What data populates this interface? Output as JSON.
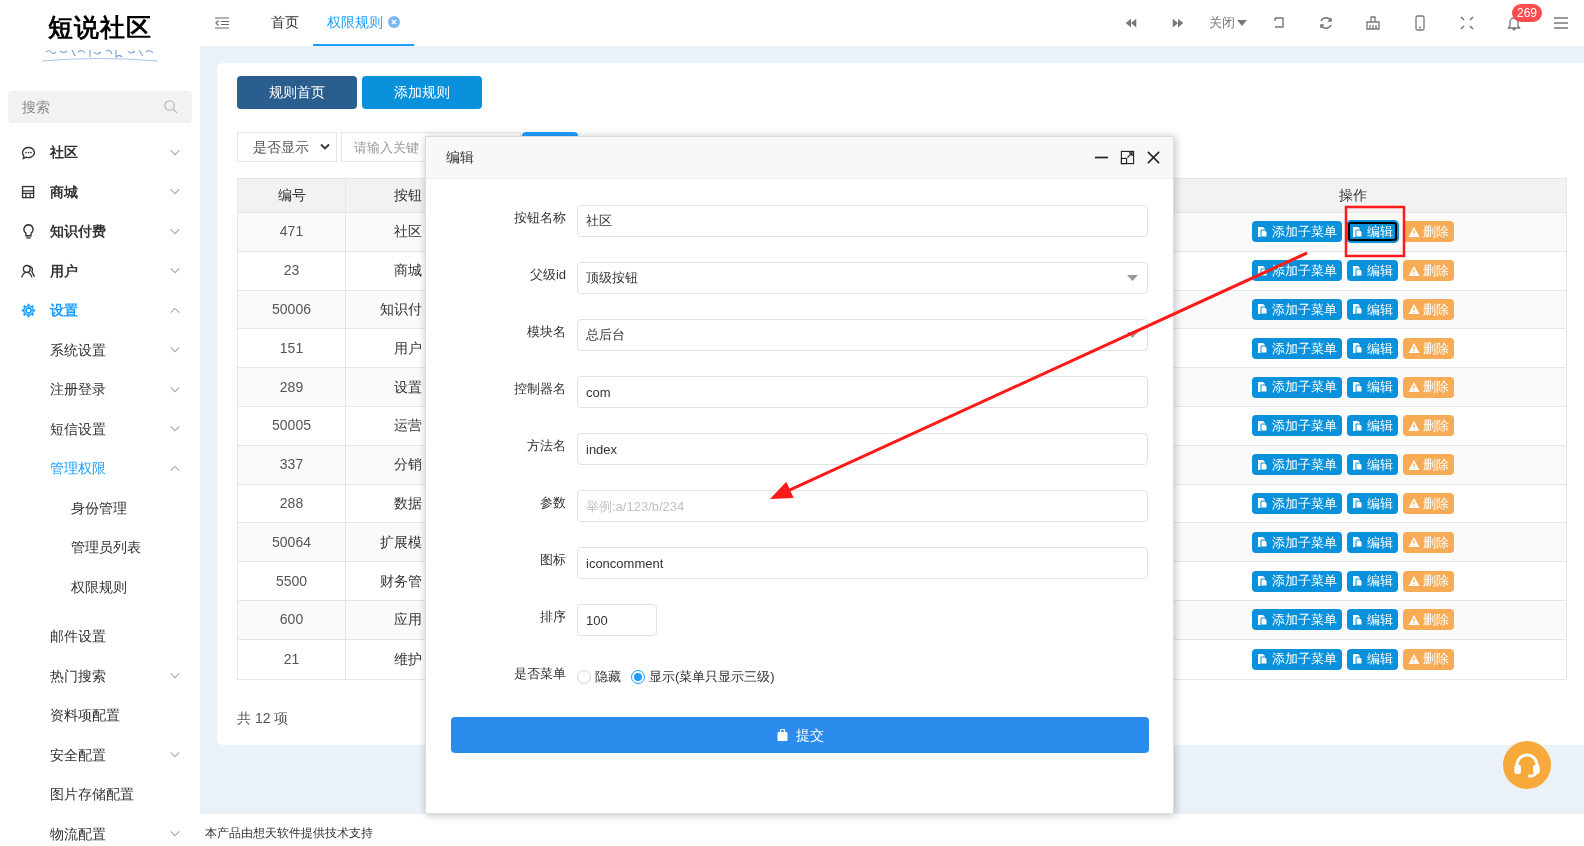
{
  "sidebar": {
    "logo": "短说社区",
    "search": {
      "placeholder": "搜索"
    },
    "items": [
      {
        "label": "社区",
        "expandable": true,
        "expanded": false
      },
      {
        "label": "商城",
        "expandable": true,
        "expanded": false
      },
      {
        "label": "知识付费",
        "expandable": true,
        "expanded": false
      },
      {
        "label": "用户",
        "expandable": true,
        "expanded": false
      },
      {
        "label": "设置",
        "expandable": true,
        "expanded": true,
        "children": [
          {
            "label": "系统设置",
            "expandable": true,
            "expanded": false
          },
          {
            "label": "注册登录",
            "expandable": true,
            "expanded": false
          },
          {
            "label": "短信设置",
            "expandable": true,
            "expanded": false
          },
          {
            "label": "管理权限",
            "expandable": true,
            "expanded": true,
            "children": [
              {
                "label": "身份管理"
              },
              {
                "label": "管理员列表"
              },
              {
                "label": "权限规则"
              }
            ]
          },
          {
            "label": "邮件设置",
            "expandable": false,
            "expanded": false
          },
          {
            "label": "热门搜索",
            "expandable": true,
            "expanded": false
          },
          {
            "label": "资料项配置",
            "expandable": false,
            "expanded": false
          },
          {
            "label": "安全配置",
            "expandable": true,
            "expanded": false
          },
          {
            "label": "图片存储配置",
            "expandable": false,
            "expanded": false
          },
          {
            "label": "物流配置",
            "expandable": true,
            "expanded": false
          }
        ]
      }
    ]
  },
  "tabs": [
    {
      "label": "首页",
      "selected": false,
      "closable": false
    },
    {
      "label": "权限规则",
      "selected": true,
      "closable": true
    }
  ],
  "toolbar": {
    "close_menu": "关闭",
    "notification_count": "269"
  },
  "page_buttons": [
    {
      "label": "规则首页",
      "selected": true
    },
    {
      "label": "添加规则",
      "selected": false
    }
  ],
  "filter": {
    "select": "是否显示",
    "keyword_placeholder": "请输入关键"
  },
  "table": {
    "columns": [
      "编号",
      "按钮",
      "操作"
    ],
    "rows": [
      {
        "id": "471",
        "name": "社区",
        "actions": [
          {
            "kind": "add",
            "label": "添加子菜单",
            "focused": false
          },
          {
            "kind": "edit",
            "label": "编辑",
            "focused": true
          },
          {
            "kind": "delete",
            "label": "删除",
            "focused": false
          }
        ]
      },
      {
        "id": "23",
        "name": "商城",
        "actions": [
          {
            "kind": "add",
            "label": "添加子菜单",
            "focused": false
          },
          {
            "kind": "edit",
            "label": "编辑",
            "focused": false
          },
          {
            "kind": "delete",
            "label": "删除",
            "focused": false
          }
        ]
      },
      {
        "id": "50006",
        "name": "知识付",
        "actions": [
          {
            "kind": "add",
            "label": "添加子菜单",
            "focused": false
          },
          {
            "kind": "edit",
            "label": "编辑",
            "focused": false
          },
          {
            "kind": "delete",
            "label": "删除",
            "focused": false
          }
        ]
      },
      {
        "id": "151",
        "name": "用户",
        "actions": [
          {
            "kind": "add",
            "label": "添加子菜单",
            "focused": false
          },
          {
            "kind": "edit",
            "label": "编辑",
            "focused": false
          },
          {
            "kind": "delete",
            "label": "删除",
            "focused": false
          }
        ]
      },
      {
        "id": "289",
        "name": "设置",
        "actions": [
          {
            "kind": "add",
            "label": "添加子菜单",
            "focused": false
          },
          {
            "kind": "edit",
            "label": "编辑",
            "focused": false
          },
          {
            "kind": "delete",
            "label": "删除",
            "focused": false
          }
        ]
      },
      {
        "id": "50005",
        "name": "运营",
        "actions": [
          {
            "kind": "add",
            "label": "添加子菜单",
            "focused": false
          },
          {
            "kind": "edit",
            "label": "编辑",
            "focused": false
          },
          {
            "kind": "delete",
            "label": "删除",
            "focused": false
          }
        ]
      },
      {
        "id": "337",
        "name": "分销",
        "actions": [
          {
            "kind": "add",
            "label": "添加子菜单",
            "focused": false
          },
          {
            "kind": "edit",
            "label": "编辑",
            "focused": false
          },
          {
            "kind": "delete",
            "label": "删除",
            "focused": false
          }
        ]
      },
      {
        "id": "288",
        "name": "数据",
        "actions": [
          {
            "kind": "add",
            "label": "添加子菜单",
            "focused": false
          },
          {
            "kind": "edit",
            "label": "编辑",
            "focused": false
          },
          {
            "kind": "delete",
            "label": "删除",
            "focused": false
          }
        ]
      },
      {
        "id": "50064",
        "name": "扩展模",
        "actions": [
          {
            "kind": "add",
            "label": "添加子菜单",
            "focused": false
          },
          {
            "kind": "edit",
            "label": "编辑",
            "focused": false
          },
          {
            "kind": "delete",
            "label": "删除",
            "focused": false
          }
        ]
      },
      {
        "id": "5500",
        "name": "财务管",
        "actions": [
          {
            "kind": "add",
            "label": "添加子菜单",
            "focused": false
          },
          {
            "kind": "edit",
            "label": "编辑",
            "focused": false
          },
          {
            "kind": "delete",
            "label": "删除",
            "focused": false
          }
        ]
      },
      {
        "id": "600",
        "name": "应用",
        "actions": [
          {
            "kind": "add",
            "label": "添加子菜单",
            "focused": false
          },
          {
            "kind": "edit",
            "label": "编辑",
            "focused": false
          },
          {
            "kind": "delete",
            "label": "删除",
            "focused": false
          }
        ]
      },
      {
        "id": "21",
        "name": "维护",
        "actions": [
          {
            "kind": "add",
            "label": "添加子菜单",
            "focused": false
          },
          {
            "kind": "edit",
            "label": "编辑",
            "focused": false
          },
          {
            "kind": "delete",
            "label": "删除",
            "focused": false
          }
        ]
      }
    ]
  },
  "total": "共 12 项",
  "dialog": {
    "title": "编辑",
    "fields": [
      {
        "label": "按钮名称",
        "kind": "text",
        "value": "社区"
      },
      {
        "label": "父级id",
        "kind": "select",
        "value": "顶级按钮"
      },
      {
        "label": "模块名",
        "kind": "select",
        "value": "总后台"
      },
      {
        "label": "控制器名",
        "kind": "text",
        "value": "com"
      },
      {
        "label": "方法名",
        "kind": "text",
        "value": "index"
      },
      {
        "label": "参数",
        "kind": "text",
        "placeholder": "举例:a/123/b/234"
      },
      {
        "label": "图标",
        "kind": "text",
        "value": "iconcomment"
      },
      {
        "label": "排序",
        "kind": "short",
        "value": "100"
      },
      {
        "label": "是否菜单",
        "kind": "radio",
        "options": [
          {
            "label": "隐藏",
            "selected": false
          },
          {
            "label": "显示(菜单只显示三级)",
            "selected": true
          }
        ]
      }
    ],
    "submit": "提交"
  },
  "footer": "本产品由想天软件提供技术支持"
}
